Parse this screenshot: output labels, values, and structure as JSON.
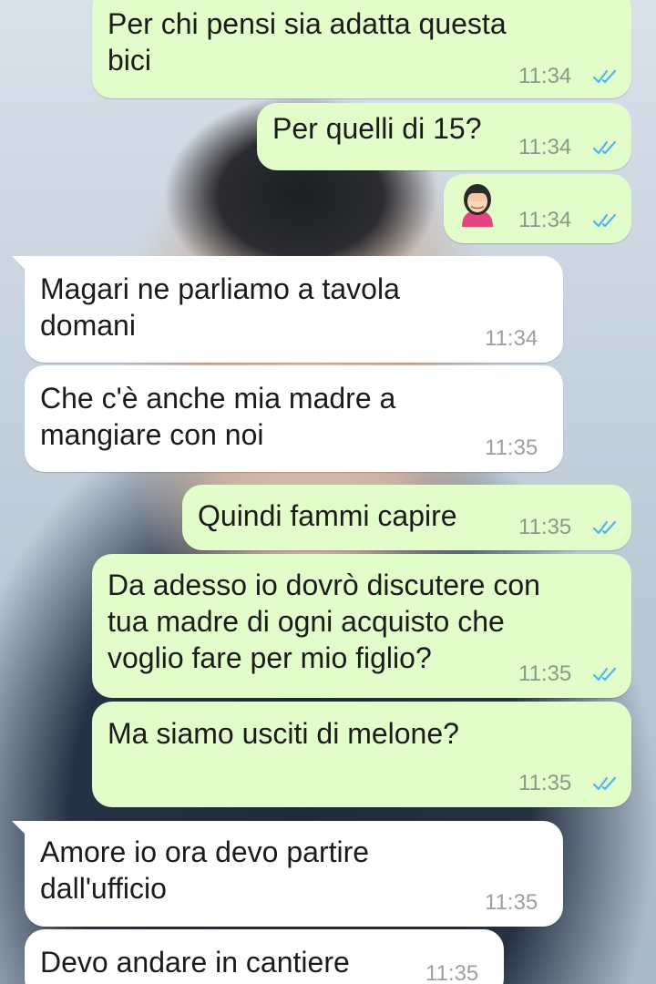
{
  "messages": [
    {
      "direction": "out",
      "text": "Per chi pensi sia adatta questa\nbici",
      "time": "11:34",
      "read": true
    },
    {
      "direction": "out",
      "text": "Per quelli di 15?",
      "time": "11:34",
      "read": true
    },
    {
      "direction": "out",
      "emoji": "woman-facepalming-emoji",
      "time": "11:34",
      "read": true
    },
    {
      "direction": "in",
      "text": "Magari ne parliamo a tavola\ndomani",
      "time": "11:34"
    },
    {
      "direction": "in",
      "text": "Che c'è anche mia madre a\nmangiare con noi",
      "time": "11:35"
    },
    {
      "direction": "out",
      "text": "Quindi fammi capire",
      "time": "11:35",
      "read": true
    },
    {
      "direction": "out",
      "text": "Da adesso io dovrò discutere con\ntua madre di ogni acquisto che\nvoglio fare per mio figlio?",
      "time": "11:35",
      "read": true
    },
    {
      "direction": "out",
      "text": "Ma siamo usciti di melone?",
      "time": "11:35",
      "read": true
    },
    {
      "direction": "in",
      "text": "Amore io ora devo partire\ndall'ufficio",
      "time": "11:35"
    },
    {
      "direction": "in",
      "text": "Devo andare in cantiere",
      "time": "11:35"
    }
  ],
  "colors": {
    "outgoing_bubble": "#e2fdca",
    "incoming_bubble": "#ffffff",
    "read_ticks": "#4fb6ec"
  },
  "icons": {
    "read_receipt": "double-check-icon"
  }
}
